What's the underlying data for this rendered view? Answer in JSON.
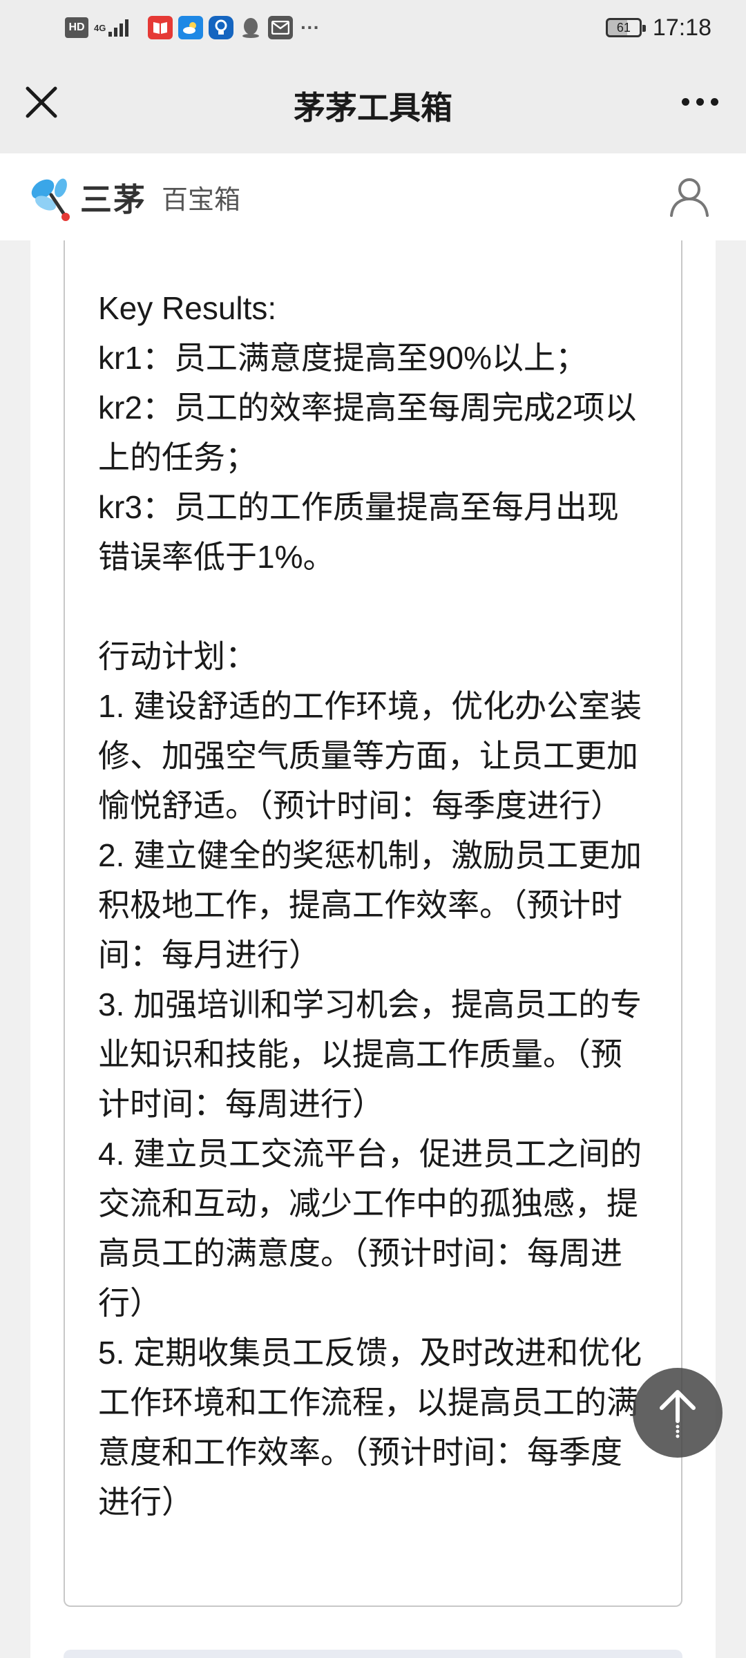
{
  "status_bar": {
    "network": "4G",
    "battery": "61",
    "time": "17:18"
  },
  "titlebar": {
    "title": "茅茅工具箱"
  },
  "header": {
    "logo_text": "三茅",
    "subtitle": "百宝箱"
  },
  "content": {
    "text": "Key Results:\nkr1：员工满意度提高至90%以上；\nkr2：员工的效率提高至每周完成2项以上的任务；\nkr3：员工的工作质量提高至每月出现错误率低于1%。\n\n行动计划：\n1. 建设舒适的工作环境，优化办公室装修、加强空气质量等方面，让员工更加愉悦舒适。（预计时间：每季度进行）\n2. 建立健全的奖惩机制，激励员工更加积极地工作，提高工作效率。（预计时间：每月进行）\n3. 加强培训和学习机会，提高员工的专业知识和技能，以提高工作质量。（预计时间：每周进行）\n4. 建立员工交流平台，促进员工之间的交流和互动，减少工作中的孤独感，提高员工的满意度。（预计时间：每周进行）\n5. 定期收集员工反馈，及时改进和优化工作环境和工作流程，以提高员工的满意度和工作效率。（预计时间：每季度进行）"
  },
  "colors": {
    "page_bg": "#ededed",
    "card_border": "#c8c8c8",
    "logo_blue": "#3aa6e8",
    "logo_red": "#e53935",
    "fab_bg": "#464646"
  },
  "icons": {
    "close": "close-icon",
    "more": "more-dots-icon",
    "user": "user-icon",
    "scroll_top": "arrow-up-icon"
  }
}
